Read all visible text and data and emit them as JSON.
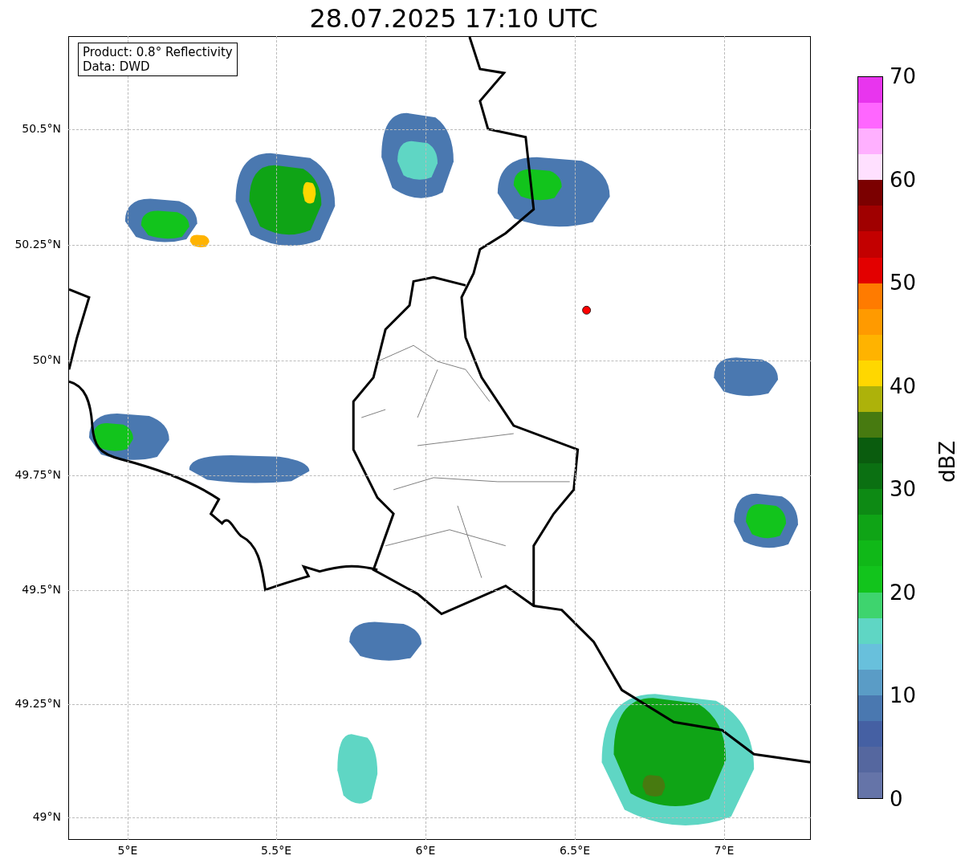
{
  "title": "28.07.2025 17:10 UTC",
  "info_box": [
    "Product: 0.8° Reflectivity",
    "Data: DWD"
  ],
  "y_ticks": [
    "50.5°N",
    "50.25°N",
    "50°N",
    "49.75°N",
    "49.5°N",
    "49.25°N",
    "49°N"
  ],
  "x_ticks": [
    "5°E",
    "5.5°E",
    "6°E",
    "6.5°E",
    "7°E"
  ],
  "colorbar": {
    "label": "dBZ",
    "ticks": [
      "70",
      "60",
      "50",
      "40",
      "30",
      "20",
      "10",
      "0"
    ],
    "segments": [
      {
        "color": "#e835ee"
      },
      {
        "color": "#ff66ff"
      },
      {
        "color": "#ffb0ff"
      },
      {
        "color": "#ffe0ff"
      },
      {
        "color": "#7b0000"
      },
      {
        "color": "#a00000"
      },
      {
        "color": "#c30000"
      },
      {
        "color": "#e30000"
      },
      {
        "color": "#ff7b00"
      },
      {
        "color": "#ff9a00"
      },
      {
        "color": "#ffb300"
      },
      {
        "color": "#ffd700"
      },
      {
        "color": "#adb20a"
      },
      {
        "color": "#477a10"
      },
      {
        "color": "#0a5c0e"
      },
      {
        "color": "#0b7012"
      },
      {
        "color": "#0d8a14"
      },
      {
        "color": "#0fa416"
      },
      {
        "color": "#10b818"
      },
      {
        "color": "#12c41c"
      },
      {
        "color": "#3ed46e"
      },
      {
        "color": "#5fd6c4"
      },
      {
        "color": "#68c0dc"
      },
      {
        "color": "#5a9cc6"
      },
      {
        "color": "#4a78b0"
      },
      {
        "color": "#4560a3"
      },
      {
        "color": "#55679f"
      },
      {
        "color": "#6574a8"
      }
    ]
  }
}
